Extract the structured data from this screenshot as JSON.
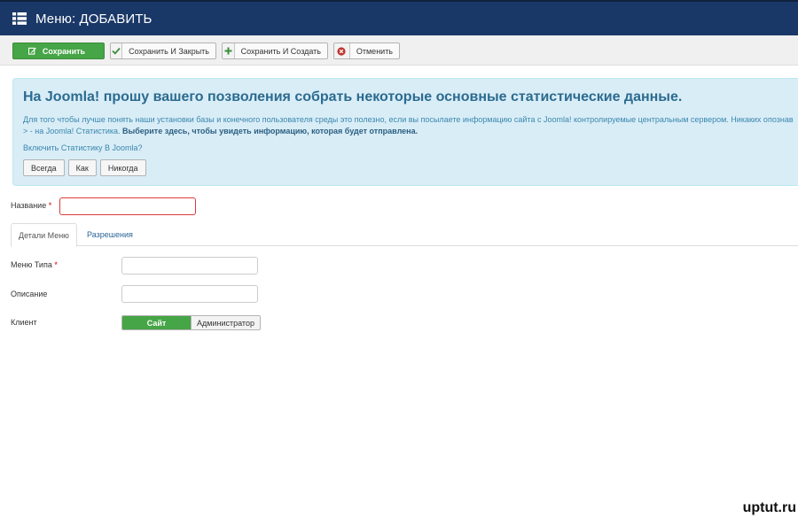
{
  "header": {
    "title": "Меню: ДОБАВИТЬ",
    "icon": "grid-list-icon"
  },
  "toolbar": {
    "save_label": "Сохранить",
    "save_close_label": "Сохранить И Закрыть",
    "save_new_label": "Сохранить И Создать",
    "cancel_label": "Отменить"
  },
  "stats_alert": {
    "heading": "На Joomla! прошу вашего позволения собрать некоторые основные статистические данные.",
    "description_line1": "Для того чтобы лучше понять наши установки базы и конечного пользователя среды это полезно, если вы посылаете информацию сайта с Joomla! контролируемые центральным сервером. Никаких опознав",
    "description_line2_prefix": "> - на Joomla! Статистика.",
    "description_line2_bold": "Выберите здесь, чтобы увидеть информацию, которая будет отправлена.",
    "question": "Включить Статистику В Joomla?",
    "buttons": {
      "always": "Всегда",
      "once": "Как",
      "never": "Никогда"
    }
  },
  "form": {
    "title_label": "Название",
    "required_mark": "*",
    "title_value": "",
    "tabs": {
      "details": "Детали Меню",
      "permissions": "Разрешения"
    },
    "menu_type_label": "Меню Типа",
    "menu_type_value": "",
    "description_label": "Описание",
    "description_value": "",
    "client_label": "Клиент",
    "client_options": {
      "site": "Сайт",
      "admin": "Администратор"
    },
    "client_selected": "Сайт"
  },
  "watermark": "uptut.ru",
  "colors": {
    "header_bg": "#1a3867",
    "primary_green": "#46a546",
    "alert_bg": "#d9edf7",
    "alert_text": "#3a87ad",
    "invalid_border": "#e03a3a"
  }
}
